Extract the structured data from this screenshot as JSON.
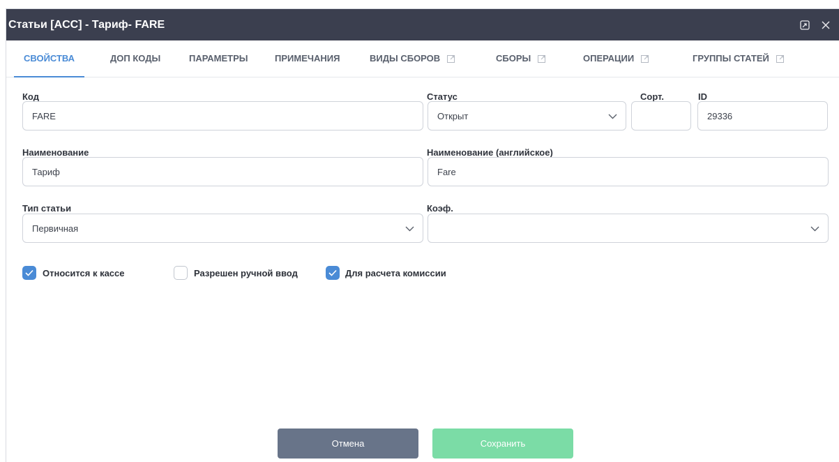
{
  "window": {
    "title": "Статьи [ACC] - Тариф- FARE",
    "restore_icon": "restore-window-icon",
    "close_icon": "close-icon"
  },
  "tabs": [
    {
      "label": "СВОЙСТВА",
      "active": true
    },
    {
      "label": "ДОП КОДЫ"
    },
    {
      "label": "ПАРАМЕТРЫ"
    },
    {
      "label": "ПРИМЕЧАНИЯ"
    },
    {
      "label": "ВИДЫ СБОРОВ",
      "external": true
    },
    {
      "label": "СБОРЫ",
      "external": true
    },
    {
      "label": "ОПЕРАЦИИ",
      "external": true
    },
    {
      "label": "ГРУППЫ СТАТЕЙ",
      "external": true
    }
  ],
  "form": {
    "code": {
      "label": "Код",
      "value": "FARE"
    },
    "status": {
      "label": "Статус",
      "value": "Открыт"
    },
    "sort": {
      "label": "Сорт.",
      "value": ""
    },
    "id": {
      "label": "ID",
      "value": "29336"
    },
    "name": {
      "label": "Наименование",
      "value": "Тариф"
    },
    "name_en": {
      "label": "Наименование (английское)",
      "value": "Fare"
    },
    "item_type": {
      "label": "Тип статьи",
      "value": "Первичная"
    },
    "coef": {
      "label": "Коэф.",
      "value": ""
    }
  },
  "checkboxes": [
    {
      "label": "Относится к кассе",
      "checked": true
    },
    {
      "label": "Разрешен ручной ввод",
      "checked": false
    },
    {
      "label": "Для расчета комиссии",
      "checked": true
    }
  ],
  "buttons": {
    "cancel": "Отмена",
    "save": "Сохранить"
  },
  "colors": {
    "titlebar": "#3b3f4f",
    "accent": "#4a8bd6",
    "cancel": "#687489",
    "save": "#7bdca6"
  }
}
